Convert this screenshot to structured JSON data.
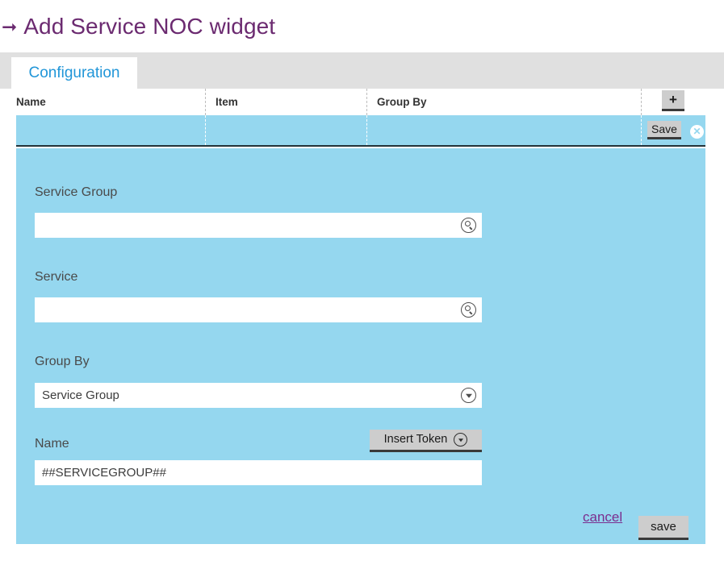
{
  "header": {
    "back_icon": "back-arrow-icon",
    "title": "Add Service NOC widget",
    "accent_purple": "#6b2a70"
  },
  "tabs": [
    {
      "label": "Configuration",
      "active": true,
      "color": "#2196d8"
    }
  ],
  "grid": {
    "columns": [
      "Name",
      "Item",
      "Group By"
    ],
    "add_button_label": "+",
    "selected_row": {
      "name": "",
      "item": "",
      "group_by": "",
      "save_label": "Save",
      "close_icon": "close-circle-icon"
    },
    "row_highlight_color": "#95d7ef"
  },
  "form": {
    "fields": [
      {
        "label": "Service Group",
        "value": "",
        "placeholder": "",
        "icon": "search-icon",
        "type": "lookup"
      },
      {
        "label": "Service",
        "value": "",
        "placeholder": "",
        "icon": "search-icon",
        "type": "lookup"
      },
      {
        "label": "Group By",
        "value": "Service Group",
        "placeholder": "",
        "icon": "chevron-down-icon",
        "type": "select"
      },
      {
        "label": "Name",
        "value": "##SERVICEGROUP##",
        "placeholder": "",
        "icon": "",
        "type": "text"
      }
    ],
    "insert_token": {
      "label": "Insert Token",
      "icon": "chevron-down-icon"
    },
    "actions": {
      "cancel_label": "cancel",
      "save_label": "save"
    },
    "panel_color": "#95d7ef"
  }
}
